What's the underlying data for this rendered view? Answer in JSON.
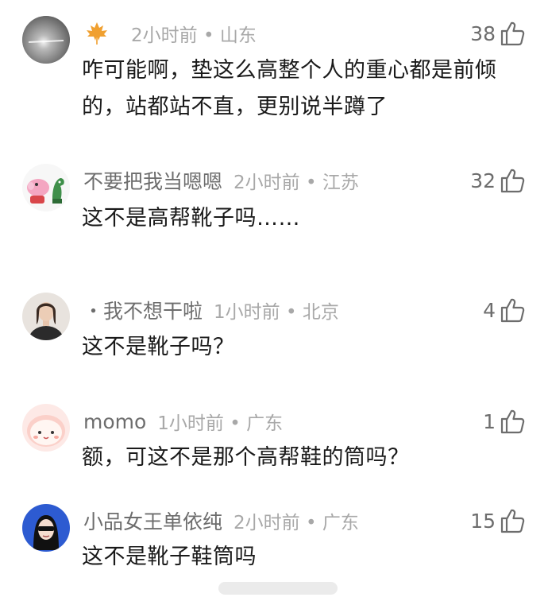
{
  "comments": [
    {
      "username": "",
      "time_location": "2小时前 • 山东",
      "likes": "38",
      "text": "咋可能啊，垫这么高整个人的重心都是前倾的，站都站不直，更别说半蹲了",
      "badge_icon": "maple-leaf-icon"
    },
    {
      "username": "不要把我当嗯嗯",
      "time_location": "2小时前 • 江苏",
      "likes": "32",
      "text": "这不是高帮靴子吗……"
    },
    {
      "username": "・我不想干啦",
      "time_location": "1小时前 • 北京",
      "likes": "4",
      "text": "这不是靴子吗？"
    },
    {
      "username": "momo",
      "time_location": "1小时前 • 广东",
      "likes": "1",
      "text": "额，可这不是那个高帮鞋的筒吗？"
    },
    {
      "username": "小品女王单依纯",
      "time_location": "2小时前 • 广东",
      "likes": "15",
      "text": "这不是靴子鞋筒吗"
    }
  ],
  "colors": {
    "username": "#6d6d6d",
    "meta": "#a8a8a8",
    "text": "#1a1a1a",
    "leaf": "#f0a030"
  }
}
